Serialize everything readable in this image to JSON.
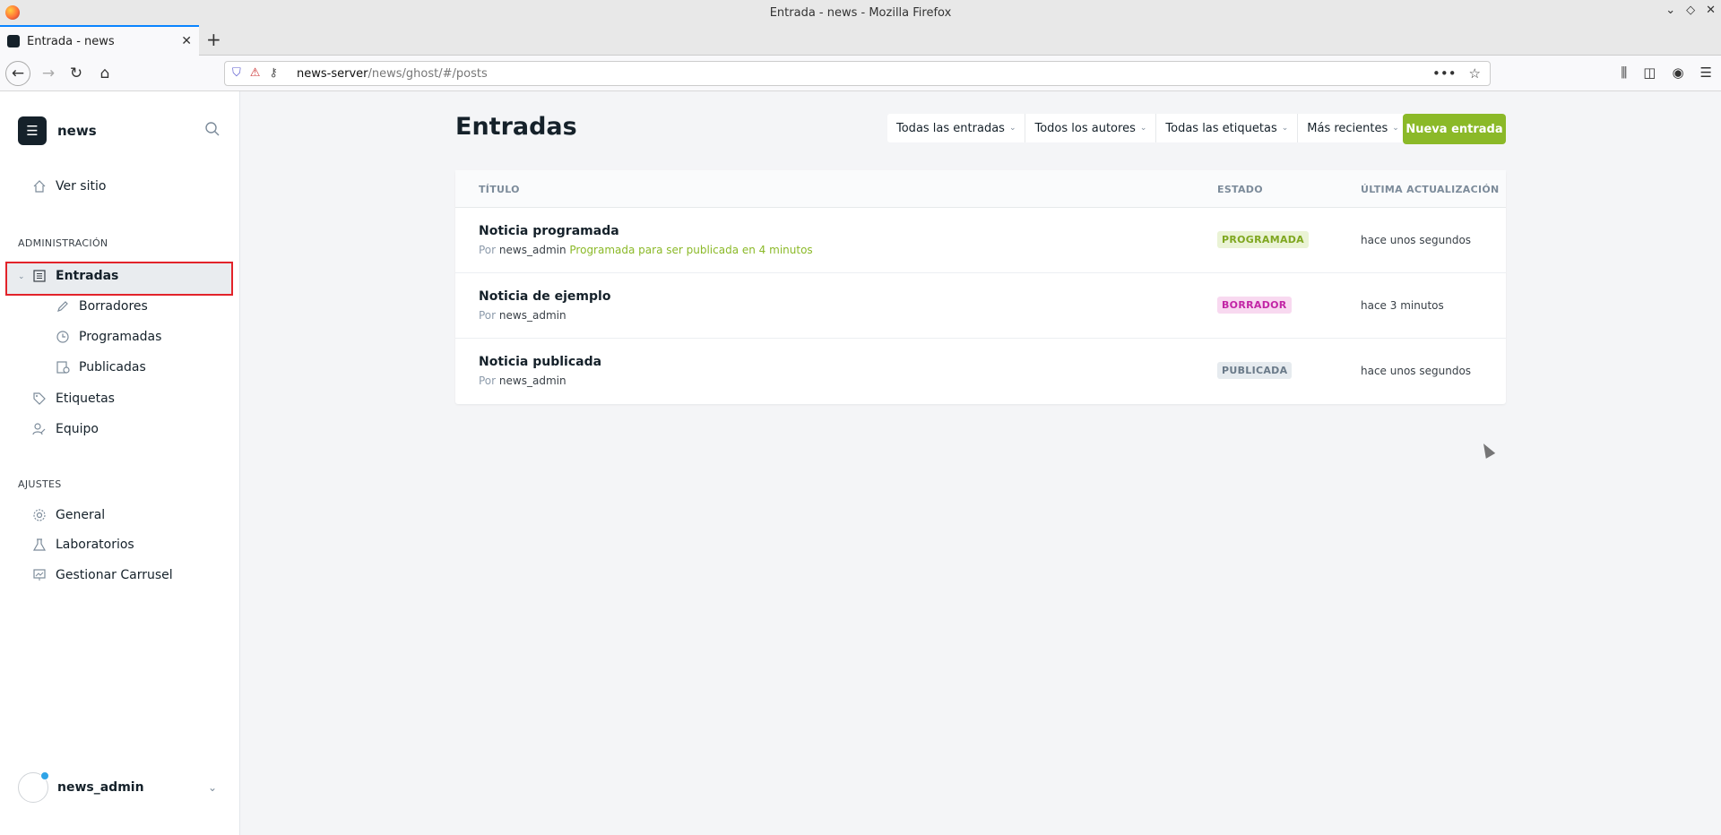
{
  "window": {
    "title": "Entrada - news - Mozilla Firefox"
  },
  "browser": {
    "tab_label": "Entrada - news",
    "url_host": "news-server",
    "url_path": "/news/ghost/#/posts"
  },
  "sidebar": {
    "brand_name": "news",
    "view_site": "Ver sitio",
    "section_admin": "ADMINISTRACIÓN",
    "items": [
      {
        "label": "Entradas"
      },
      {
        "label": "Borradores"
      },
      {
        "label": "Programadas"
      },
      {
        "label": "Publicadas"
      },
      {
        "label": "Etiquetas"
      },
      {
        "label": "Equipo"
      }
    ],
    "section_settings": "AJUSTES",
    "settings_items": [
      {
        "label": "General"
      },
      {
        "label": "Laboratorios"
      },
      {
        "label": "Gestionar Carrusel"
      }
    ],
    "user_name": "news_admin"
  },
  "main": {
    "page_title": "Entradas",
    "filters": [
      {
        "label": "Todas las entradas"
      },
      {
        "label": "Todos los autores"
      },
      {
        "label": "Todas las etiquetas"
      },
      {
        "label": "Más recientes"
      }
    ],
    "new_button": "Nueva entrada",
    "columns": {
      "title": "TÍTULO",
      "status": "ESTADO",
      "updated": "ÚLTIMA ACTUALIZACIÓN"
    },
    "posts": [
      {
        "title": "Noticia programada",
        "by": "Por",
        "author": "news_admin",
        "schedule_note": "Programada para ser publicada en 4 minutos",
        "status": "PROGRAMADA",
        "updated": "hace unos segundos"
      },
      {
        "title": "Noticia de ejemplo",
        "by": "Por",
        "author": "news_admin",
        "schedule_note": "",
        "status": "BORRADOR",
        "updated": "hace 3 minutos"
      },
      {
        "title": "Noticia publicada",
        "by": "Por",
        "author": "news_admin",
        "schedule_note": "",
        "status": "PUBLICADA",
        "updated": "hace unos segundos"
      }
    ]
  },
  "colors": {
    "accent_green": "#8bb928",
    "highlight_border": "#e2232a",
    "badge_scheduled_bg": "#eaf3d5",
    "badge_scheduled_fg": "#7fa720",
    "badge_draft_bg": "#f8d9f0",
    "badge_draft_fg": "#c225a5",
    "badge_published_bg": "#e6ebef",
    "badge_published_fg": "#6a7a89"
  },
  "icons": {
    "home": "home-icon",
    "posts": "posts-icon",
    "pencil": "pencil-icon",
    "clock": "clock-icon",
    "published": "published-icon",
    "tag": "tag-icon",
    "team": "team-icon",
    "gear": "gear-icon",
    "labs": "flask-icon",
    "carousel": "carousel-icon",
    "search": "search-icon"
  }
}
